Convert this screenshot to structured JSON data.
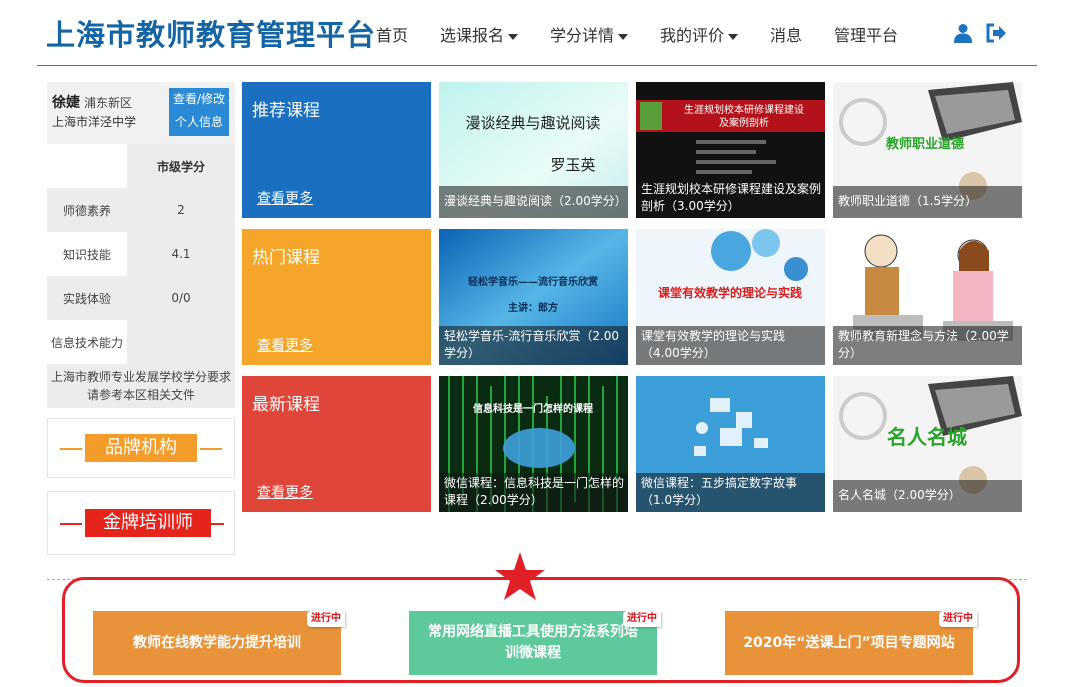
{
  "header": {
    "logo": "上海市教师教育管理平台",
    "nav": [
      "首页",
      "选课报名",
      "学分详情",
      "我的评价",
      "消息",
      "管理平台"
    ],
    "user_icon": "user-icon",
    "logout_icon": "logout-icon",
    "accent_color": "#1565a5"
  },
  "user": {
    "name": "徐婕",
    "district": "浦东新区",
    "school": "上海市洋泾中学",
    "edit_line1": "查看/修改",
    "edit_line2": "个人信息"
  },
  "credits": {
    "column_header": "市级学分",
    "rows": [
      {
        "label": "师德素养",
        "value": "2"
      },
      {
        "label": "知识技能",
        "value": "4.1"
      },
      {
        "label": "实践体验",
        "value": "0/0"
      },
      {
        "label": "信息技术能力",
        "value": ""
      }
    ],
    "note_line1": "上海市教师专业发展学校学分要求",
    "note_line2": "请参考本区相关文件"
  },
  "promos": [
    {
      "label": "品牌机构",
      "color": "#f39c29"
    },
    {
      "label": "金牌培训师",
      "color": "#e5241c"
    }
  ],
  "categories": [
    {
      "title": "推荐课程",
      "more": "查看更多",
      "color": "#1a6fc0"
    },
    {
      "title": "热门课程",
      "more": "查看更多",
      "color": "#f5a62a"
    },
    {
      "title": "最新课程",
      "more": "查看更多",
      "color": "#e0453a"
    }
  ],
  "courses": [
    [
      {
        "caption": "漫谈经典与趣说阅读（2.00学分）",
        "thumb_title": "漫谈经典与趣说阅读",
        "thumb_author": "罗玉英"
      },
      {
        "caption": "生涯规划校本研修课程建设及案例剖析（3.00学分）",
        "thumb_title": "生涯规划校本研修课程建设",
        "thumb_sub": "及案例剖析"
      },
      {
        "caption": "教师职业道德（1.5学分）",
        "thumb_title": "教师职业道德"
      }
    ],
    [
      {
        "caption": "轻松学音乐-流行音乐欣赏（2.00学分）",
        "thumb_title": "轻松学音乐——流行音乐欣赏",
        "thumb_sub": "主讲：郎方"
      },
      {
        "caption": "课堂有效教学的理论与实践（4.00学分）",
        "thumb_title": "课堂有效教学的理论与实践"
      },
      {
        "caption": "教师教育新理念与方法（2.00学分）"
      }
    ],
    [
      {
        "caption": "微信课程：信息科技是一门怎样的课程（2.00学分）",
        "thumb_title": "信息科技是一门怎样的课程"
      },
      {
        "caption": "微信课程：五步搞定数字故事（1.0学分）"
      },
      {
        "caption": "名人名城（2.00学分）",
        "thumb_title": "名人名城"
      }
    ]
  ],
  "bottom": {
    "buttons": [
      {
        "label": "教师在线教学能力提升培训",
        "badge": "进行中",
        "color": "#e8923a"
      },
      {
        "label": "常用网络直播工具使用方法系列培训微课程",
        "badge": "进行中",
        "color": "#5ec99a"
      },
      {
        "label": "2020年“送课上门”项目专题网站",
        "badge": "进行中",
        "color": "#e8923a"
      }
    ],
    "frame_color": "#e11f26"
  }
}
